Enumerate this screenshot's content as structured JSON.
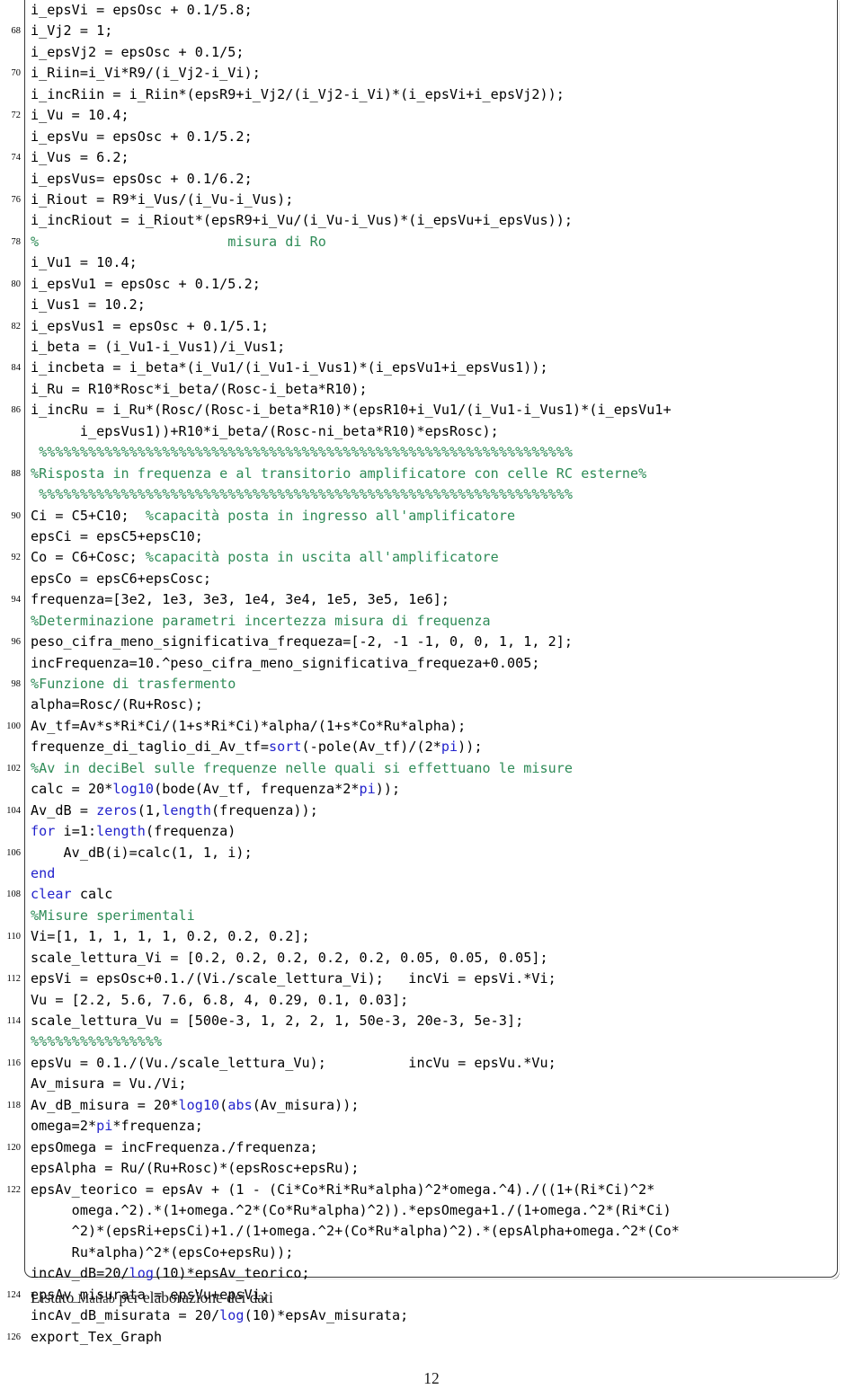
{
  "document": {
    "page_number": "12",
    "caption_prefix": "Listato ",
    "caption_smallcaps": "Matlab",
    "caption_suffix": " per elaborazione dei dati",
    "colors": {
      "comment": "#2e8b57",
      "keyword": "#2222cc",
      "text": "#000000",
      "frame": "#3a3a3a",
      "background": "#ffffff"
    }
  },
  "listing": {
    "first_line_number": 67,
    "number_step": 2,
    "lines": [
      {
        "n": "",
        "tokens": [
          {
            "t": "i_epsVi = epsOsc + 0.1/5.8;"
          }
        ]
      },
      {
        "n": "68",
        "tokens": [
          {
            "t": "i_Vj2 = 1;"
          }
        ]
      },
      {
        "n": "",
        "tokens": [
          {
            "t": "i_epsVj2 = epsOsc + 0.1/5;"
          }
        ]
      },
      {
        "n": "70",
        "tokens": [
          {
            "t": "i_Riin=i_Vi*R9/(i_Vj2-i_Vi);"
          }
        ]
      },
      {
        "n": "",
        "tokens": [
          {
            "t": "i_incRiin = i_Riin*(epsR9+i_Vj2/(i_Vj2-i_Vi)*(i_epsVi+i_epsVj2));"
          }
        ]
      },
      {
        "n": "72",
        "tokens": [
          {
            "t": "i_Vu = 10.4;"
          }
        ]
      },
      {
        "n": "",
        "tokens": [
          {
            "t": "i_epsVu = epsOsc + 0.1/5.2;"
          }
        ]
      },
      {
        "n": "74",
        "tokens": [
          {
            "t": "i_Vus = 6.2;"
          }
        ]
      },
      {
        "n": "",
        "tokens": [
          {
            "t": "i_epsVus= epsOsc + 0.1/6.2;"
          }
        ]
      },
      {
        "n": "76",
        "tokens": [
          {
            "t": "i_Riout = R9*i_Vus/(i_Vu-i_Vus);"
          }
        ]
      },
      {
        "n": "",
        "tokens": [
          {
            "t": "i_incRiout = i_Riout*(epsR9+i_Vu/(i_Vu-i_Vus)*(i_epsVu+i_epsVus));"
          }
        ]
      },
      {
        "n": "78",
        "tokens": [
          {
            "c": "cmt",
            "t": "%                       misura di Ro"
          }
        ]
      },
      {
        "n": "",
        "tokens": [
          {
            "t": "i_Vu1 = 10.4;"
          }
        ]
      },
      {
        "n": "80",
        "tokens": [
          {
            "t": "i_epsVu1 = epsOsc + 0.1/5.2;"
          }
        ]
      },
      {
        "n": "",
        "tokens": [
          {
            "t": "i_Vus1 = 10.2;"
          }
        ]
      },
      {
        "n": "82",
        "tokens": [
          {
            "t": "i_epsVus1 = epsOsc + 0.1/5.1;"
          }
        ]
      },
      {
        "n": "",
        "tokens": [
          {
            "t": "i_beta = (i_Vu1-i_Vus1)/i_Vus1;"
          }
        ]
      },
      {
        "n": "84",
        "tokens": [
          {
            "t": "i_incbeta = i_beta*(i_Vu1/(i_Vu1-i_Vus1)*(i_epsVu1+i_epsVus1));"
          }
        ]
      },
      {
        "n": "",
        "tokens": [
          {
            "t": "i_Ru = R10*Rosc*i_beta/(Rosc-i_beta*R10);"
          }
        ]
      },
      {
        "n": "86",
        "tokens": [
          {
            "t": "i_incRu = i_Ru*(Rosc/(Rosc-i_beta*R10)*(epsR10+i_Vu1/(i_Vu1-i_Vus1)*(i_epsVu1+"
          }
        ]
      },
      {
        "n": "",
        "tokens": [
          {
            "t": "      i_epsVus1))+R10*i_beta/(Rosc-ni_beta*R10)*epsRosc);"
          }
        ]
      },
      {
        "n": "",
        "tokens": [
          {
            "c": "cmt",
            "t": " %%%%%%%%%%%%%%%%%%%%%%%%%%%%%%%%%%%%%%%%%%%%%%%%%%%%%%%%%%%%%%%%%"
          }
        ]
      },
      {
        "n": "88",
        "tokens": [
          {
            "c": "cmt",
            "t": "%Risposta in frequenza e al transitorio amplificatore con celle RC esterne%"
          }
        ]
      },
      {
        "n": "",
        "tokens": [
          {
            "c": "cmt",
            "t": " %%%%%%%%%%%%%%%%%%%%%%%%%%%%%%%%%%%%%%%%%%%%%%%%%%%%%%%%%%%%%%%%%"
          }
        ]
      },
      {
        "n": "90",
        "tokens": [
          {
            "t": "Ci = C5+C10;  "
          },
          {
            "c": "cmt",
            "t": "%capacità posta in ingresso all'amplificatore"
          }
        ]
      },
      {
        "n": "",
        "tokens": [
          {
            "t": "epsCi = epsC5+epsC10;"
          }
        ]
      },
      {
        "n": "92",
        "tokens": [
          {
            "t": "Co = C6+Cosc; "
          },
          {
            "c": "cmt",
            "t": "%capacità posta in uscita all'amplificatore"
          }
        ]
      },
      {
        "n": "",
        "tokens": [
          {
            "t": "epsCo = epsC6+epsCosc;"
          }
        ]
      },
      {
        "n": "94",
        "tokens": [
          {
            "t": "frequenza=[3e2, 1e3, 3e3, 1e4, 3e4, 1e5, 3e5, 1e6];"
          }
        ]
      },
      {
        "n": "",
        "tokens": [
          {
            "c": "cmt",
            "t": "%Determinazione parametri incertezza misura di frequenza"
          }
        ]
      },
      {
        "n": "96",
        "tokens": [
          {
            "t": "peso_cifra_meno_significativa_frequeza=[-2, -1 -1, 0, 0, 1, 1, 2];"
          }
        ]
      },
      {
        "n": "",
        "tokens": [
          {
            "t": "incFrequenza=10.^peso_cifra_meno_significativa_frequeza+0.005;"
          }
        ]
      },
      {
        "n": "98",
        "tokens": [
          {
            "c": "cmt",
            "t": "%Funzione di trasfermento"
          }
        ]
      },
      {
        "n": "",
        "tokens": [
          {
            "t": "alpha=Rosc/(Ru+Rosc);"
          }
        ]
      },
      {
        "n": "100",
        "tokens": [
          {
            "t": "Av_tf=Av*s*Ri*Ci/(1+s*Ri*Ci)*alpha/(1+s*Co*Ru*alpha);"
          }
        ]
      },
      {
        "n": "",
        "tokens": [
          {
            "t": "frequenze_di_taglio_di_Av_tf="
          },
          {
            "c": "kw",
            "t": "sort"
          },
          {
            "t": "(-pole(Av_tf)/(2*"
          },
          {
            "c": "kw",
            "t": "pi"
          },
          {
            "t": "));"
          }
        ]
      },
      {
        "n": "102",
        "tokens": [
          {
            "c": "cmt",
            "t": "%Av in deciBel sulle frequenze nelle quali si effettuano le misure"
          }
        ]
      },
      {
        "n": "",
        "tokens": [
          {
            "t": "calc = 20*"
          },
          {
            "c": "kw",
            "t": "log10"
          },
          {
            "t": "(bode(Av_tf, frequenza*2*"
          },
          {
            "c": "kw",
            "t": "pi"
          },
          {
            "t": "));"
          }
        ]
      },
      {
        "n": "104",
        "tokens": [
          {
            "t": "Av_dB = "
          },
          {
            "c": "kw",
            "t": "zeros"
          },
          {
            "t": "(1,"
          },
          {
            "c": "kw",
            "t": "length"
          },
          {
            "t": "(frequenza));"
          }
        ]
      },
      {
        "n": "",
        "tokens": [
          {
            "c": "kw",
            "t": "for"
          },
          {
            "t": " i=1:"
          },
          {
            "c": "kw",
            "t": "length"
          },
          {
            "t": "(frequenza)"
          }
        ]
      },
      {
        "n": "106",
        "tokens": [
          {
            "t": "    Av_dB(i)=calc(1, 1, i);"
          }
        ]
      },
      {
        "n": "",
        "tokens": [
          {
            "c": "kw",
            "t": "end"
          }
        ]
      },
      {
        "n": "108",
        "tokens": [
          {
            "c": "kw",
            "t": "clear"
          },
          {
            "t": " calc"
          }
        ]
      },
      {
        "n": "",
        "tokens": [
          {
            "c": "cmt",
            "t": "%Misure sperimentali"
          }
        ]
      },
      {
        "n": "110",
        "tokens": [
          {
            "t": "Vi=[1, 1, 1, 1, 1, 0.2, 0.2, 0.2];"
          }
        ]
      },
      {
        "n": "",
        "tokens": [
          {
            "t": "scale_lettura_Vi = [0.2, 0.2, 0.2, 0.2, 0.2, 0.05, 0.05, 0.05];"
          }
        ]
      },
      {
        "n": "112",
        "tokens": [
          {
            "t": "epsVi = epsOsc+0.1./(Vi./scale_lettura_Vi);   incVi = epsVi.*Vi;"
          }
        ]
      },
      {
        "n": "",
        "tokens": [
          {
            "t": "Vu = [2.2, 5.6, 7.6, 6.8, 4, 0.29, 0.1, 0.03];"
          }
        ]
      },
      {
        "n": "114",
        "tokens": [
          {
            "t": "scale_lettura_Vu = [500e-3, 1, 2, 2, 1, 50e-3, 20e-3, 5e-3];"
          }
        ]
      },
      {
        "n": "",
        "tokens": [
          {
            "c": "cmt",
            "t": "%%%%%%%%%%%%%%%%"
          }
        ]
      },
      {
        "n": "116",
        "tokens": [
          {
            "t": "epsVu = 0.1./(Vu./scale_lettura_Vu);          incVu = epsVu.*Vu;"
          }
        ]
      },
      {
        "n": "",
        "tokens": [
          {
            "t": "Av_misura = Vu./Vi;"
          }
        ]
      },
      {
        "n": "118",
        "tokens": [
          {
            "t": "Av_dB_misura = 20*"
          },
          {
            "c": "kw",
            "t": "log10"
          },
          {
            "t": "("
          },
          {
            "c": "kw",
            "t": "abs"
          },
          {
            "t": "(Av_misura));"
          }
        ]
      },
      {
        "n": "",
        "tokens": [
          {
            "t": "omega=2*"
          },
          {
            "c": "kw",
            "t": "pi"
          },
          {
            "t": "*frequenza;"
          }
        ]
      },
      {
        "n": "120",
        "tokens": [
          {
            "t": "epsOmega = incFrequenza./frequenza;"
          }
        ]
      },
      {
        "n": "",
        "tokens": [
          {
            "t": "epsAlpha = Ru/(Ru+Rosc)*(epsRosc+epsRu);"
          }
        ]
      },
      {
        "n": "122",
        "tokens": [
          {
            "t": "epsAv_teorico = epsAv + (1 - (Ci*Co*Ri*Ru*alpha)^2*omega.^4)./((1+(Ri*Ci)^2*"
          }
        ]
      },
      {
        "n": "",
        "tokens": [
          {
            "t": "     omega.^2).*(1+omega.^2*(Co*Ru*alpha)^2)).*epsOmega+1./(1+omega.^2*(Ri*Ci)"
          }
        ]
      },
      {
        "n": "",
        "tokens": [
          {
            "t": "     ^2)*(epsRi+epsCi)+1./(1+omega.^2+(Co*Ru*alpha)^2).*(epsAlpha+omega.^2*(Co*"
          }
        ]
      },
      {
        "n": "",
        "tokens": [
          {
            "t": "     Ru*alpha)^2*(epsCo+epsRu));"
          }
        ]
      },
      {
        "n": "",
        "tokens": [
          {
            "t": "incAv_dB=20/"
          },
          {
            "c": "kw",
            "t": "log"
          },
          {
            "t": "(10)*epsAv_teorico;"
          }
        ]
      },
      {
        "n": "124",
        "tokens": [
          {
            "t": "epsAv_misurata = epsVu+epsVi;"
          }
        ]
      },
      {
        "n": "",
        "tokens": [
          {
            "t": "incAv_dB_misurata = 20/"
          },
          {
            "c": "kw",
            "t": "log"
          },
          {
            "t": "(10)*epsAv_misurata;"
          }
        ]
      },
      {
        "n": "126",
        "tokens": [
          {
            "t": "export_Tex_Graph"
          }
        ]
      }
    ]
  }
}
